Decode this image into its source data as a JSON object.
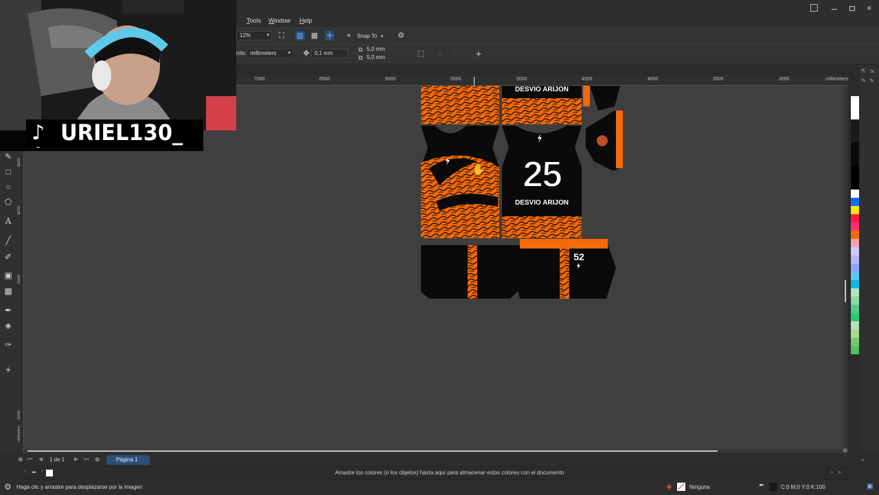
{
  "menu": [
    "Tools",
    "Window",
    "Help"
  ],
  "toolbar": {
    "zoom_value": "12%",
    "snap_label": "Snap To"
  },
  "propertybar": {
    "units_label": "nits:",
    "units_value": "millimeters",
    "nudge_value": "0,1 mm",
    "dup_x": "5,0 mm",
    "dup_y": "5,0 mm"
  },
  "ruler": {
    "top_labels": [
      "7000",
      "6500",
      "6000",
      "5500",
      "5000",
      "4500",
      "4000",
      "3500",
      "3000"
    ],
    "unit": "millimeters",
    "left_labels": [
      "3500",
      "3000",
      "2500",
      "2000"
    ],
    "left_unit": "millimeters"
  },
  "design": {
    "name_top": "DESVIO ARIJON",
    "number": "25",
    "name_front": "DESVIO ARIJON",
    "short_number": "52"
  },
  "pagebar": {
    "page_count": "1 de 1",
    "page_tab": "Página 1"
  },
  "colorbar": {
    "hint": "Arrastre los colores (o los objetos) hasta aquí para almacenar estos colores con el documento"
  },
  "status": {
    "message": "Haga clic y arrastre para desplazarse por la imagen",
    "fill_label": "Ninguna",
    "cmyk": "C:0 M:0 Y:0 K:100"
  },
  "overlay": {
    "handle": "URIEL130_"
  },
  "colors": {
    "orange": "#f26a0a",
    "black": "#0a0a0a",
    "canvas": "#3f3f3f",
    "accent": "#2c4f78"
  },
  "palette": [
    "#ffffff",
    "#1a1a1a",
    "#0a0a0a",
    "#000000",
    "#ffffff",
    "#0d6efd",
    "#ffe600",
    "#ff1744",
    "#ff2d6f",
    "#f26a0a",
    "#f5a3b0",
    "#d4c8ff",
    "#b7b7ff",
    "#8fa5ff",
    "#61c5f5",
    "#0fb6e8",
    "#b2e6c6",
    "#8cd9a3",
    "#54c98a",
    "#2ec87a",
    "#b5e3b5",
    "#a8d98f",
    "#7cc96b",
    "#55c15e"
  ]
}
